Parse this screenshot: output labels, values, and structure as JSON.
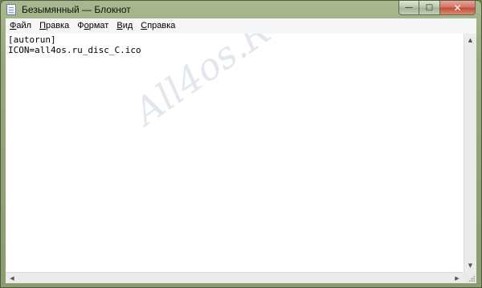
{
  "window": {
    "title": "Безымянный — Блокнот",
    "controls": {
      "minimize": "—",
      "maximize": "□",
      "close": "✕"
    }
  },
  "menu": [
    {
      "label": "Файл",
      "accel": "Ф",
      "rest": "айл"
    },
    {
      "label": "Правка",
      "accel": "П",
      "rest": "равка"
    },
    {
      "label": "Формат",
      "accel": "о",
      "pre": "Ф",
      "rest": "рмат"
    },
    {
      "label": "Вид",
      "accel": "В",
      "rest": "ид"
    },
    {
      "label": "Справка",
      "accel": "С",
      "rest": "правка"
    }
  ],
  "editor": {
    "lines": [
      "[autorun]",
      "ICON=all4os.ru_disc_C.ico"
    ]
  },
  "watermark": "All4os.RU",
  "icons": {
    "app": "notepad-icon",
    "scroll_up": "▲",
    "scroll_down": "▼",
    "scroll_left": "◀",
    "scroll_right": "▶"
  }
}
